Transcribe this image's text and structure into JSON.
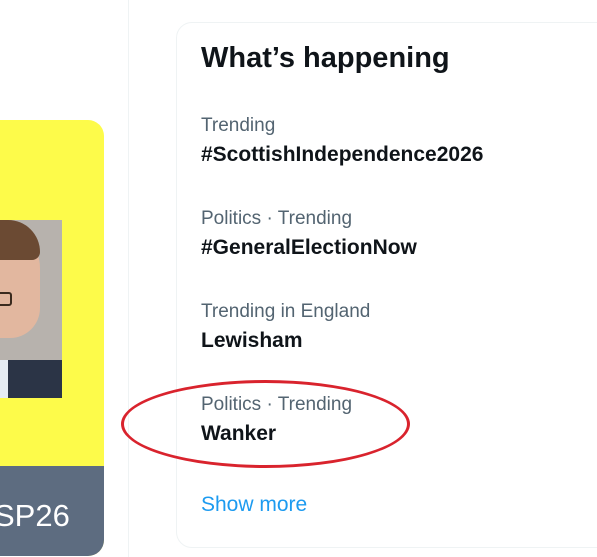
{
  "promo": {
    "banner_text": "SP26",
    "card_color": "#fdfb4a",
    "banner_color": "#5d6c80"
  },
  "trends": {
    "title": "What’s happening",
    "items": [
      {
        "meta": "Trending",
        "name": "#ScottishIndependence2026"
      },
      {
        "meta": "Politics · Trending",
        "name": "#GeneralElectionNow"
      },
      {
        "meta": "Trending in England",
        "name": "Lewisham"
      },
      {
        "meta": "Politics · Trending",
        "name": "Wanker"
      }
    ],
    "show_more": "Show more",
    "link_color": "#1d9bf0",
    "meta_color": "#536471"
  },
  "annotation": {
    "color": "#d9232d",
    "target": "trend-item-4"
  }
}
